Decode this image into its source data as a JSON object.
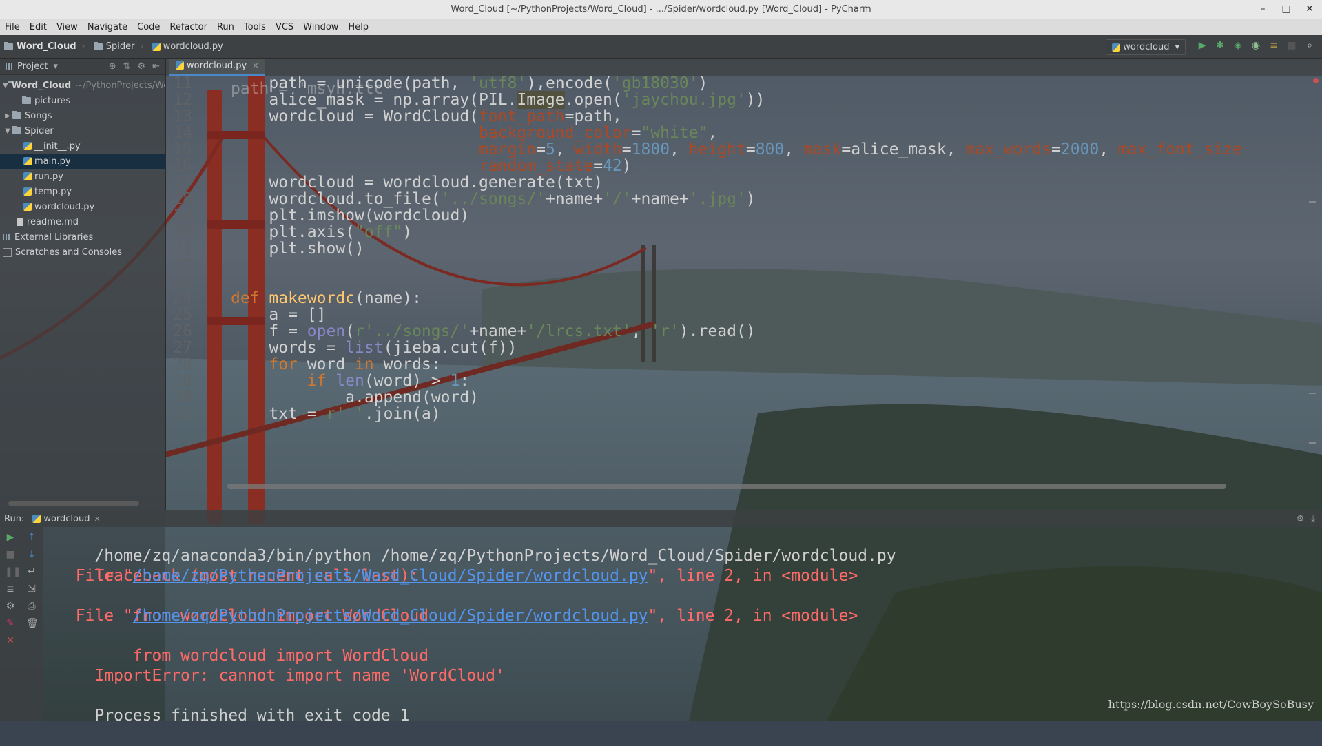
{
  "window": {
    "title": "Word_Cloud [~/PythonProjects/Word_Cloud] - .../Spider/wordcloud.py [Word_Cloud] - PyCharm",
    "minimize": "–",
    "maximize": "□",
    "close": "✕"
  },
  "menu": [
    "File",
    "Edit",
    "View",
    "Navigate",
    "Code",
    "Refactor",
    "Run",
    "Tools",
    "VCS",
    "Window",
    "Help"
  ],
  "breadcrumb": {
    "project": "Word_Cloud",
    "folder": "Spider",
    "file": "wordcloud.py"
  },
  "run_config": {
    "name": "wordcloud",
    "dropdown": "▾"
  },
  "sidebar": {
    "title": "Project",
    "dropdown": "▾",
    "root": {
      "name": "Word_Cloud",
      "path": "~/PythonProjects/Wor"
    },
    "items": [
      {
        "label": "pictures",
        "type": "folder",
        "depth": 1
      },
      {
        "label": "Songs",
        "type": "folder",
        "depth": 1,
        "collapsed": true
      },
      {
        "label": "Spider",
        "type": "folder",
        "depth": 1,
        "expanded": true
      },
      {
        "label": "__init__.py",
        "type": "py",
        "depth": 2
      },
      {
        "label": "main.py",
        "type": "py",
        "depth": 2,
        "selected": true
      },
      {
        "label": "run.py",
        "type": "py",
        "depth": 2
      },
      {
        "label": "temp.py",
        "type": "py",
        "depth": 2
      },
      {
        "label": "wordcloud.py",
        "type": "py",
        "depth": 2
      },
      {
        "label": "readme.md",
        "type": "md",
        "depth": 1
      },
      {
        "label": "External Libraries",
        "type": "lib",
        "depth": 0
      },
      {
        "label": "Scratches and Consoles",
        "type": "scratch",
        "depth": 0
      }
    ]
  },
  "editor": {
    "tab": "wordcloud.py",
    "tab_close": "✕",
    "partial_top": "path = 'msyh.ttc'",
    "lines": [
      {
        "n": "11",
        "tokens": [
          [
            "",
            "    path = unicode(path"
          ],
          [
            "s",
            ", "
          ],
          [
            "str",
            "'utf8'"
          ],
          [
            "",
            "),encode("
          ],
          [
            "str",
            "'gb18030'"
          ],
          [
            "",
            ")"
          ]
        ]
      },
      {
        "n": "12",
        "tokens": [
          [
            "",
            "    alice_mask = np.array(PIL."
          ],
          [
            "hl",
            "Image"
          ],
          [
            "",
            ".open("
          ],
          [
            "str",
            "'jaychou.jpg'"
          ],
          [
            "",
            "))"
          ]
        ]
      },
      {
        "n": "13",
        "tokens": [
          [
            "",
            "    wordcloud = WordCloud("
          ],
          [
            "param",
            "font_path"
          ],
          [
            "",
            "=path,"
          ]
        ]
      },
      {
        "n": "14",
        "tokens": [
          [
            "",
            "                          "
          ],
          [
            "param",
            "background_color"
          ],
          [
            "",
            "="
          ],
          [
            "str",
            "\"white\""
          ],
          [
            "",
            ","
          ]
        ]
      },
      {
        "n": "15",
        "tokens": [
          [
            "",
            "                          "
          ],
          [
            "param",
            "margin"
          ],
          [
            "",
            "="
          ],
          [
            "num",
            "5"
          ],
          [
            "",
            ", "
          ],
          [
            "param",
            "width"
          ],
          [
            "",
            "="
          ],
          [
            "num",
            "1800"
          ],
          [
            "",
            ", "
          ],
          [
            "param",
            "height"
          ],
          [
            "",
            "="
          ],
          [
            "num",
            "800"
          ],
          [
            "",
            ", "
          ],
          [
            "param",
            "mask"
          ],
          [
            "",
            "=alice_mask, "
          ],
          [
            "param",
            "max_words"
          ],
          [
            "",
            "="
          ],
          [
            "num",
            "2000"
          ],
          [
            "",
            ", "
          ],
          [
            "param",
            "max_font_size"
          ]
        ]
      },
      {
        "n": "16",
        "tokens": [
          [
            "",
            "                          "
          ],
          [
            "param",
            "random_state"
          ],
          [
            "",
            "="
          ],
          [
            "num",
            "42"
          ],
          [
            "",
            ")"
          ]
        ]
      },
      {
        "n": "17",
        "tokens": [
          [
            "",
            "    wordcloud = wordcloud.generate(txt)"
          ]
        ]
      },
      {
        "n": "18",
        "tokens": [
          [
            "",
            "    wordcloud.to_file("
          ],
          [
            "str",
            "'../songs/'"
          ],
          [
            "",
            "+name+"
          ],
          [
            "str",
            "'/'"
          ],
          [
            "",
            "+name+"
          ],
          [
            "str",
            "'.jpg'"
          ],
          [
            "",
            ")"
          ]
        ]
      },
      {
        "n": "19",
        "tokens": [
          [
            "",
            "    plt.imshow(wordcloud)"
          ]
        ]
      },
      {
        "n": "20",
        "tokens": [
          [
            "",
            "    plt.axis("
          ],
          [
            "str",
            "\"off\""
          ],
          [
            "",
            ")"
          ]
        ]
      },
      {
        "n": "21",
        "tokens": [
          [
            "",
            "    plt.show()"
          ]
        ]
      },
      {
        "n": "22",
        "tokens": [
          [
            "",
            ""
          ]
        ]
      },
      {
        "n": "23",
        "tokens": [
          [
            "",
            ""
          ]
        ]
      },
      {
        "n": "24",
        "tokens": [
          [
            "kw",
            "def "
          ],
          [
            "fn",
            "makewordc"
          ],
          [
            "",
            "(name):"
          ]
        ]
      },
      {
        "n": "25",
        "tokens": [
          [
            "",
            "    a = []"
          ]
        ]
      },
      {
        "n": "26",
        "tokens": [
          [
            "",
            "    f = "
          ],
          [
            "builtin",
            "open"
          ],
          [
            "",
            "("
          ],
          [
            "str",
            "r'../songs/'"
          ],
          [
            "",
            "+name+"
          ],
          [
            "str",
            "'/lrcs.txt'"
          ],
          [
            "",
            ", "
          ],
          [
            "str",
            "'r'"
          ],
          [
            "",
            ").read()"
          ]
        ]
      },
      {
        "n": "27",
        "tokens": [
          [
            "",
            "    words = "
          ],
          [
            "builtin",
            "list"
          ],
          [
            "",
            "(jieba.cut(f))"
          ]
        ]
      },
      {
        "n": "28",
        "tokens": [
          [
            "",
            "    "
          ],
          [
            "kw",
            "for "
          ],
          [
            "",
            "word "
          ],
          [
            "kw",
            "in "
          ],
          [
            "",
            "words:"
          ]
        ]
      },
      {
        "n": "29",
        "tokens": [
          [
            "",
            "        "
          ],
          [
            "kw",
            "if "
          ],
          [
            "builtin",
            "len"
          ],
          [
            "",
            "(word) > "
          ],
          [
            "num",
            "1"
          ],
          [
            "",
            ":"
          ]
        ]
      },
      {
        "n": "30",
        "tokens": [
          [
            "",
            "            a.append(word)"
          ]
        ]
      },
      {
        "n": "31",
        "tokens": [
          [
            "",
            "    txt = "
          ],
          [
            "str",
            "r' '"
          ],
          [
            "",
            ".join(a)"
          ]
        ]
      }
    ]
  },
  "run_panel": {
    "label": "Run:",
    "tab": "wordcloud",
    "tab_close": "✕",
    "console": [
      {
        "type": "plain",
        "text": "/home/zq/anaconda3/bin/python /home/zq/PythonProjects/Word_Cloud/Spider/wordcloud.py"
      },
      {
        "type": "err",
        "text": "Traceback (most recent call last):"
      },
      {
        "type": "link",
        "pre": "  File \"",
        "link": "/home/zq/PythonProjects/Word_Cloud/Spider/wordcloud.py",
        "post": "\", line 2, in <module>"
      },
      {
        "type": "err",
        "text": "    from wordcloud import WordCloud"
      },
      {
        "type": "link",
        "pre": "  File \"",
        "link": "/home/zq/PythonProjects/Word_Cloud/Spider/wordcloud.py",
        "post": "\", line 2, in <module>"
      },
      {
        "type": "err",
        "text": "    from wordcloud import WordCloud"
      },
      {
        "type": "err",
        "text": "ImportError: cannot import name 'WordCloud'"
      },
      {
        "type": "plain",
        "text": ""
      },
      {
        "type": "plain",
        "text": "Process finished with exit code 1"
      }
    ]
  },
  "watermark": "https://blog.csdn.net/CowBoySoBusy",
  "colors": {
    "keyword": "#cc7832",
    "string": "#6a8759",
    "number": "#6897bb",
    "param": "#aa4926",
    "function": "#ffc66d",
    "error": "#ff6b68",
    "link": "#5394ec"
  }
}
